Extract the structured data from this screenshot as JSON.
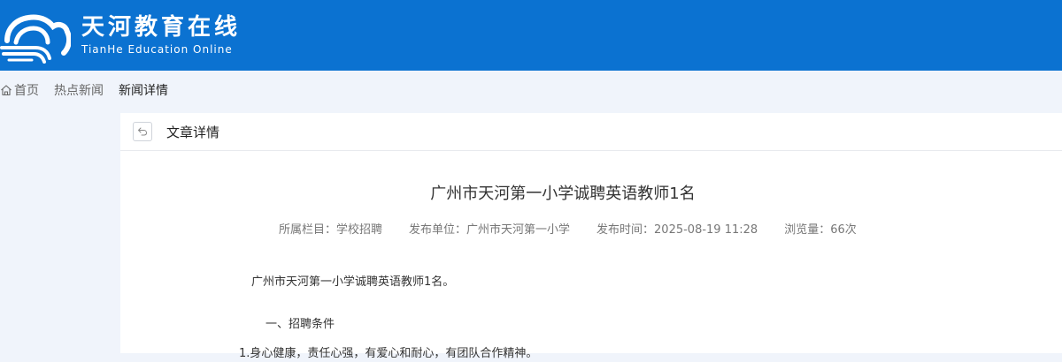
{
  "header": {
    "logo_icon": "cloud-wave-logo-icon",
    "title_cn": "天河教育在线",
    "title_en": "TianHe Education Online",
    "bg_color": "#0b72d1"
  },
  "breadcrumb": {
    "home_icon": "home-icon",
    "items": [
      "首页",
      "热点新闻",
      "新闻详情"
    ]
  },
  "card": {
    "back_icon": "return-icon",
    "title": "文章详情"
  },
  "article": {
    "title": "广州市天河第一小学诚聘英语教师1名",
    "meta": {
      "category": "所属栏目：学校招聘",
      "publisher": "发布单位：广州市天河第一小学",
      "time": "发布时间：2025-08-19 11:28",
      "views": "浏览量：66次"
    },
    "paragraphs": [
      "广州市天河第一小学诚聘英语教师1名。",
      "一、招聘条件",
      "1.身心健康，责任心强，有爱心和耐心，有团队合作精神。"
    ]
  }
}
